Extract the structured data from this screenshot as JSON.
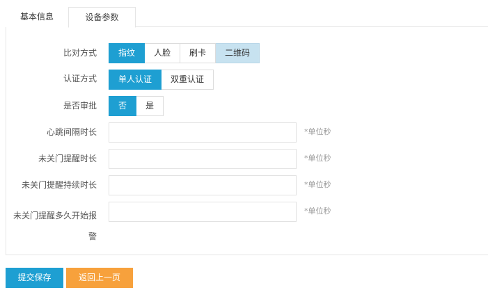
{
  "tabs": [
    {
      "label": "基本信息",
      "active": false
    },
    {
      "label": "设备参数",
      "active": true
    }
  ],
  "form": {
    "compare_mode": {
      "label": "比对方式",
      "options": [
        "指纹",
        "人脸",
        "刷卡",
        "二维码"
      ],
      "selected": "指纹"
    },
    "auth_mode": {
      "label": "认证方式",
      "options": [
        "单人认证",
        "双重认证"
      ],
      "selected": "单人认证"
    },
    "need_approval": {
      "label": "是否审批",
      "options": [
        "否",
        "是"
      ],
      "selected": "否"
    },
    "heartbeat_interval": {
      "label": "心跳间隔时长",
      "value": "",
      "unit": "*单位秒"
    },
    "door_open_reminder": {
      "label": "未关门提醒时长",
      "value": "",
      "unit": "*单位秒"
    },
    "reminder_duration": {
      "label": "未关门提醒持续时长",
      "value": "",
      "unit": "*单位秒"
    },
    "alarm_start": {
      "label": "未关门提醒多久开始报警",
      "value": "",
      "unit": "*单位秒"
    }
  },
  "actions": {
    "save_label": "提交保存",
    "back_label": "返回上一页"
  },
  "colors": {
    "primary": "#1e9fd2",
    "warning": "#f7a13c",
    "highlight": "#c7e2f0"
  }
}
